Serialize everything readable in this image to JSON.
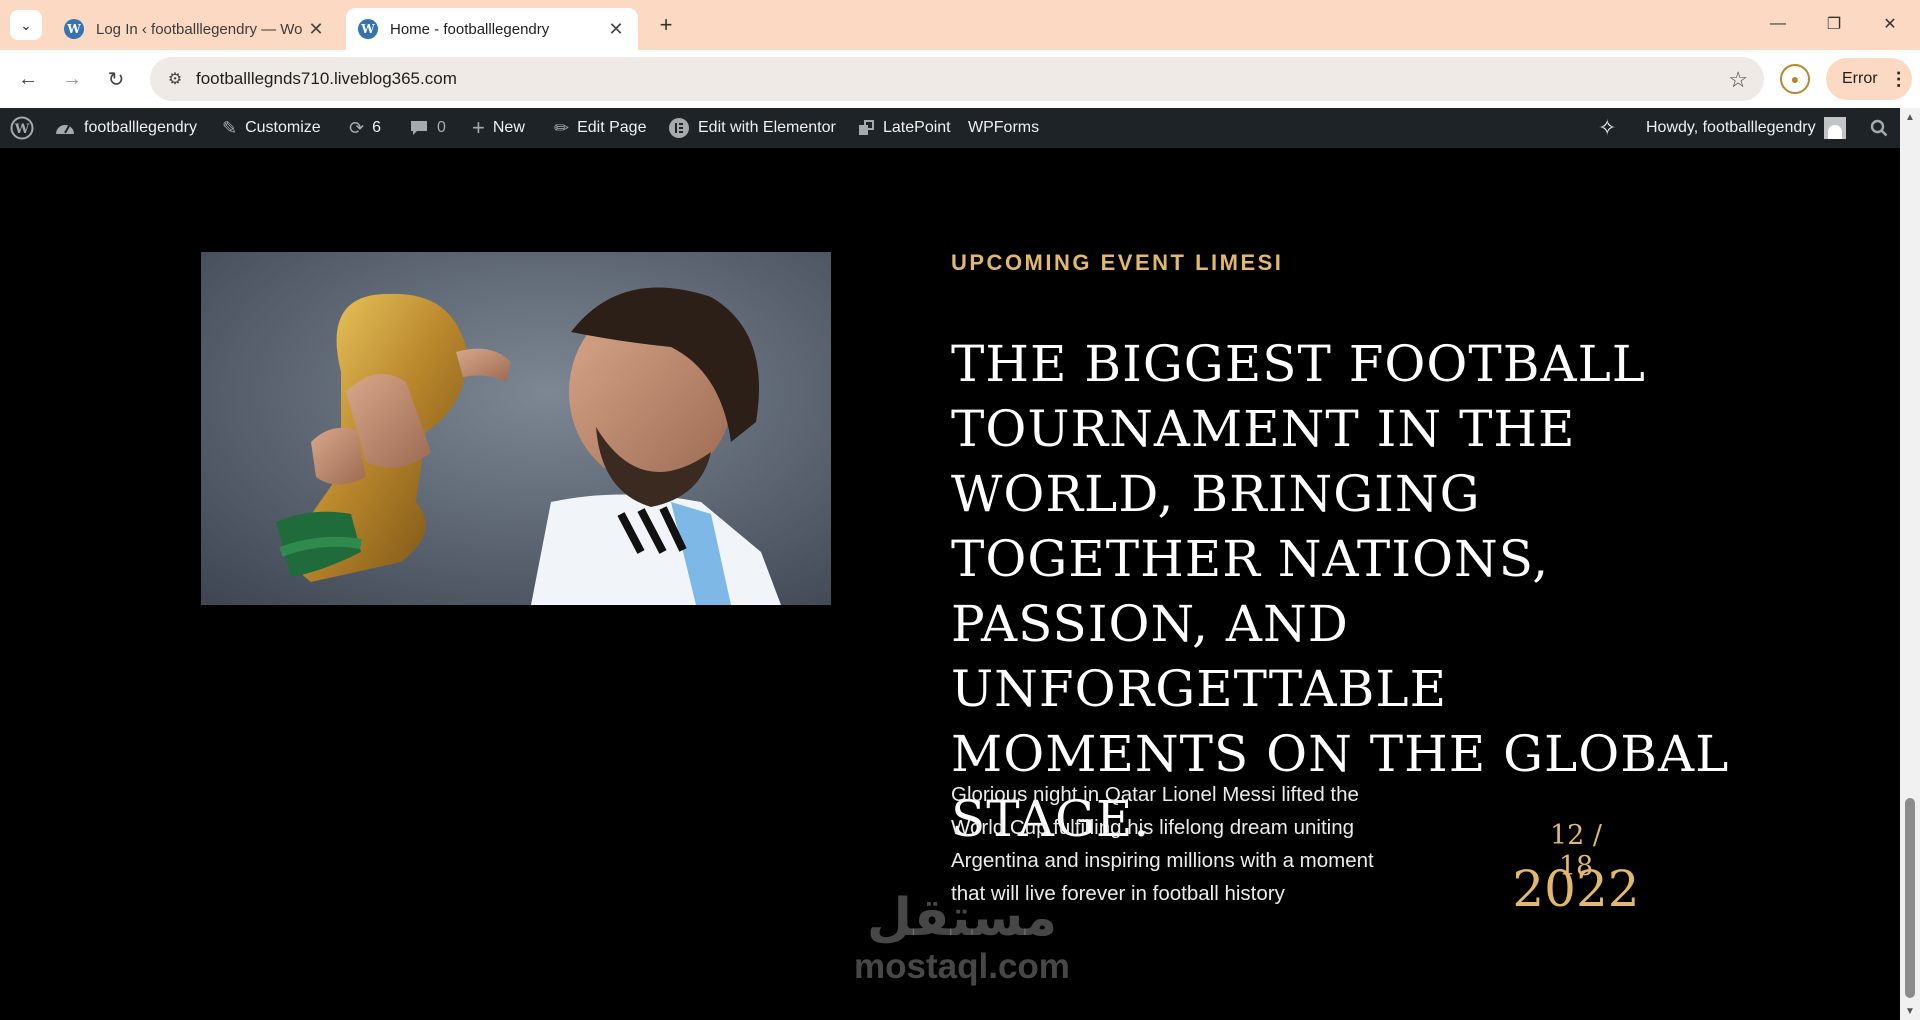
{
  "browser": {
    "tabs": [
      {
        "title": "Log In ‹ footballlegendry — Wo",
        "favicon": "W",
        "active": false
      },
      {
        "title": "Home - footballlegendry",
        "favicon": "W",
        "active": true
      }
    ],
    "url": "footballlegnds710.liveblog365.com",
    "error_label": "Error"
  },
  "adminbar": {
    "site_name": "footballlegendry",
    "customize": "Customize",
    "updates_count": "6",
    "comments_count": "0",
    "new_label": "New",
    "edit_page": "Edit Page",
    "edit_elementor": "Edit with Elementor",
    "latepoint": "LatePoint",
    "wpforms": "WPForms",
    "howdy": "Howdy, footballlegendry"
  },
  "event": {
    "eyebrow": "UPCOMING EVENT LIMESI",
    "headline": "THE BIGGEST FOOTBALL TOURNAMENT IN THE WORLD, BRINGING TOGETHER NATIONS, PASSION, AND UNFORGETTABLE MOMENTS ON THE GLOBAL STAGE.",
    "description": "Glorious night in Qatar Lionel Messi lifted the World Cup fulfilling his lifelong dream uniting Argentina and inspiring millions with a moment that will live forever in football history",
    "date_month_day": "12 / 18",
    "date_year": "2022"
  },
  "watermark": {
    "arabic": "مستقل",
    "latin": "mostaql.com"
  },
  "colors": {
    "accent_gold": "#e2b86c",
    "tabbar_bg": "#fbd9c2",
    "adminbar_bg": "#1d2327",
    "page_bg": "#000000"
  }
}
